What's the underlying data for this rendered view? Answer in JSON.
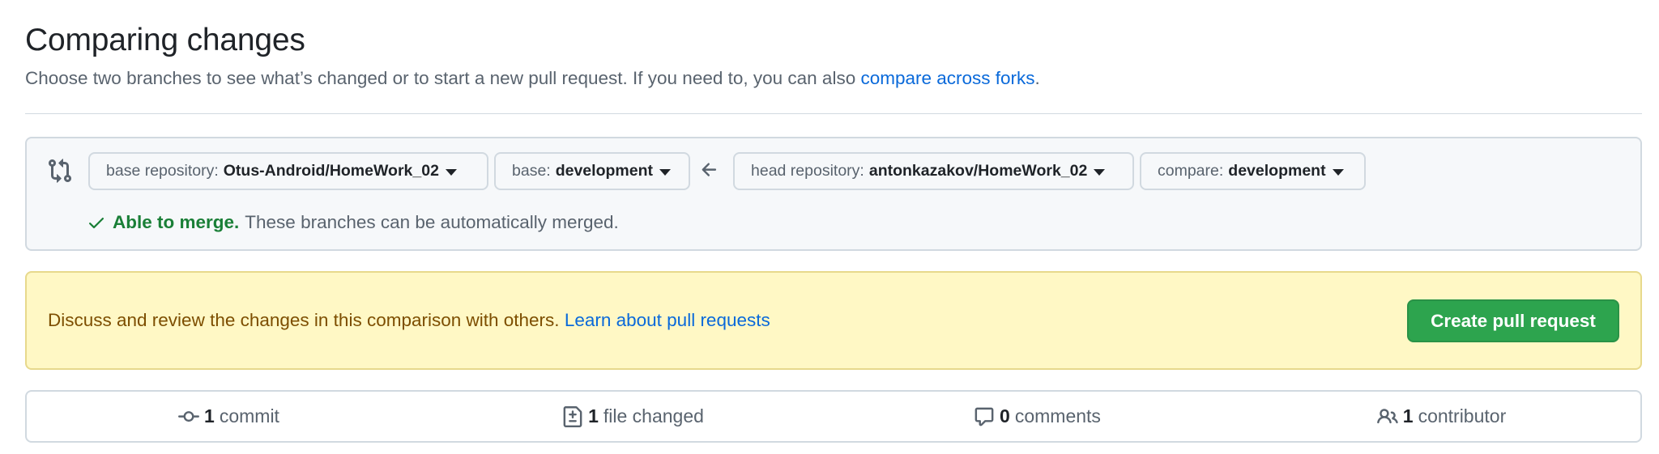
{
  "header": {
    "title": "Comparing changes",
    "subtitle_text": "Choose two branches to see what’s changed or to start a new pull request. If you need to, you can also ",
    "subtitle_link": "compare across forks",
    "subtitle_end": "."
  },
  "range": {
    "base_repo_label": "base repository:",
    "base_repo_value": "Otus-Android/HomeWork_02",
    "base_label": "base:",
    "base_value": "development",
    "head_repo_label": "head repository:",
    "head_repo_value": "antonkazakov/HomeWork_02",
    "compare_label": "compare:",
    "compare_value": "development",
    "merge_ok": "Able to merge.",
    "merge_msg": "These branches can be automatically merged."
  },
  "flash": {
    "text": "Discuss and review the changes in this comparison with others. ",
    "link": "Learn about pull requests",
    "button": "Create pull request"
  },
  "summary": {
    "commits_num": "1",
    "commits_label": "commit",
    "files_num": "1",
    "files_label": "file changed",
    "comments_num": "0",
    "comments_label": "comments",
    "contributors_num": "1",
    "contributors_label": "contributor"
  },
  "colors": {
    "link": "#0969da",
    "success": "#1a7f37",
    "primary_button": "#2da44e",
    "flash_bg": "#fff8c5",
    "flash_text": "#7d4e00"
  }
}
